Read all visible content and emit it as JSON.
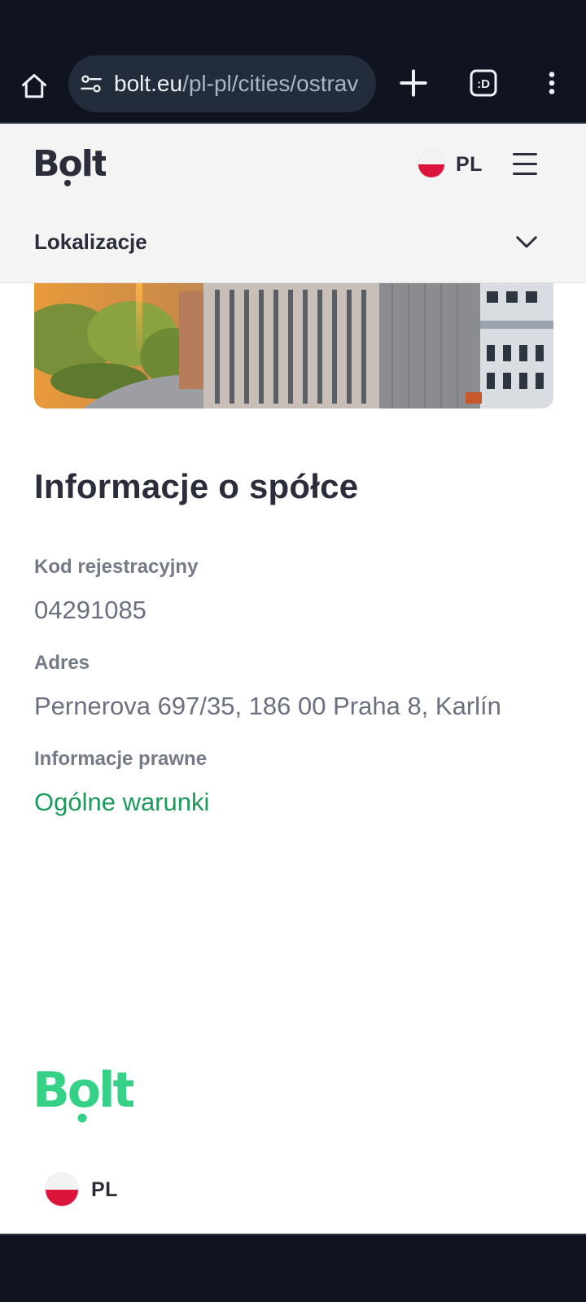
{
  "browser": {
    "url_host": "bolt.eu",
    "url_path": "/pl-pl/cities/ostrav",
    "tabs_badge": ":D"
  },
  "header": {
    "logo_text": "Bolt",
    "language": "PL",
    "locations_label": "Lokalizacje"
  },
  "company": {
    "title": "Informacje o spółce",
    "reg_label": "Kod rejestracyjny",
    "reg_value": "04291085",
    "address_label": "Adres",
    "address_value": "Pernerova 697/35, 186 00 Praha 8, Karlín",
    "legal_label": "Informacje prawne",
    "legal_link": "Ogólne warunki"
  },
  "footer": {
    "logo_text": "Bolt",
    "language": "PL"
  },
  "colors": {
    "brand_green": "#34d186",
    "link_green": "#1a9b5a",
    "header_dark": "#2b2d3a",
    "browser_bg": "#0f1420"
  },
  "icons": [
    "home-icon",
    "site-settings-icon",
    "plus-icon",
    "tabs-icon",
    "more-vert-icon",
    "poland-flag-icon",
    "hamburger-menu-icon",
    "chevron-down-icon"
  ]
}
